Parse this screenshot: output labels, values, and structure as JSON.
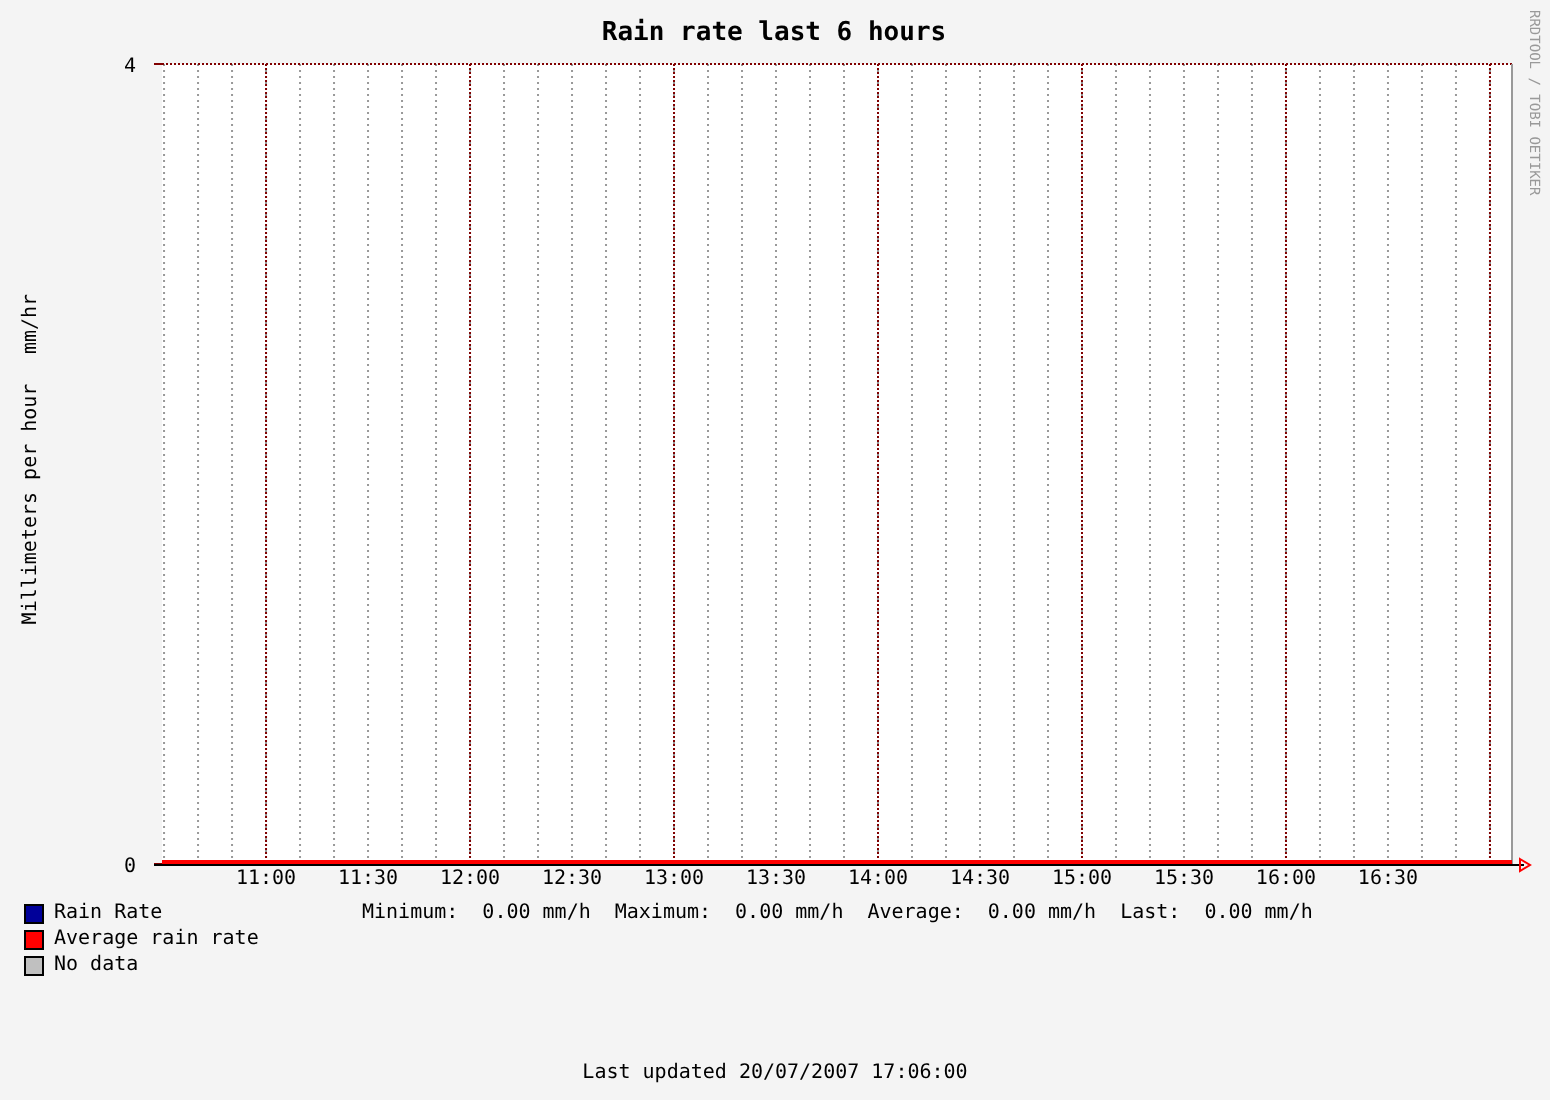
{
  "chart": {
    "chart_data": {
      "type": "line",
      "title": "Rain rate last 6 hours",
      "ylabel": "Millimeters per hour",
      "x": [
        10.49,
        17.108
      ],
      "series": [
        {
          "name": "Rain Rate",
          "color": "#000099",
          "values": [
            null,
            null
          ]
        },
        {
          "name": "Average rain rate",
          "color": "#ff0000",
          "values": [
            0,
            0
          ]
        }
      ],
      "grid": true,
      "xlim": [
        10.49,
        17.108
      ],
      "ylim": [
        0,
        4
      ],
      "yticks": [
        0,
        4
      ],
      "xticks": [
        {
          "value": 11,
          "label": "11:00"
        },
        {
          "value": 11.5,
          "label": "11:30"
        },
        {
          "value": 12,
          "label": "12:00"
        },
        {
          "value": 12.5,
          "label": "12:30"
        },
        {
          "value": 13,
          "label": "13:00"
        },
        {
          "value": 13.5,
          "label": "13:30"
        },
        {
          "value": 14,
          "label": "14:00"
        },
        {
          "value": 14.5,
          "label": "14:30"
        },
        {
          "value": 15,
          "label": "15:00"
        },
        {
          "value": 15.5,
          "label": "15:30"
        },
        {
          "value": 16,
          "label": "16:00"
        },
        {
          "value": 16.5,
          "label": "16:30"
        }
      ]
    },
    "unit_label": "mm/hr",
    "credit": "RRDTOOL / TOBI OETIKER"
  },
  "no_data_legend": {
    "label": "No data",
    "color": "#c0c0c0"
  },
  "stats": [
    {
      "label": "Minimum:",
      "value": "0.00 mm/h"
    },
    {
      "label": "Maximum:",
      "value": "0.00 mm/h"
    },
    {
      "label": "Average:",
      "value": "0.00 mm/h"
    },
    {
      "label": "Last:",
      "value": "0.00 mm/h"
    }
  ],
  "footer": "Last updated 20/07/2007 17:06:00"
}
